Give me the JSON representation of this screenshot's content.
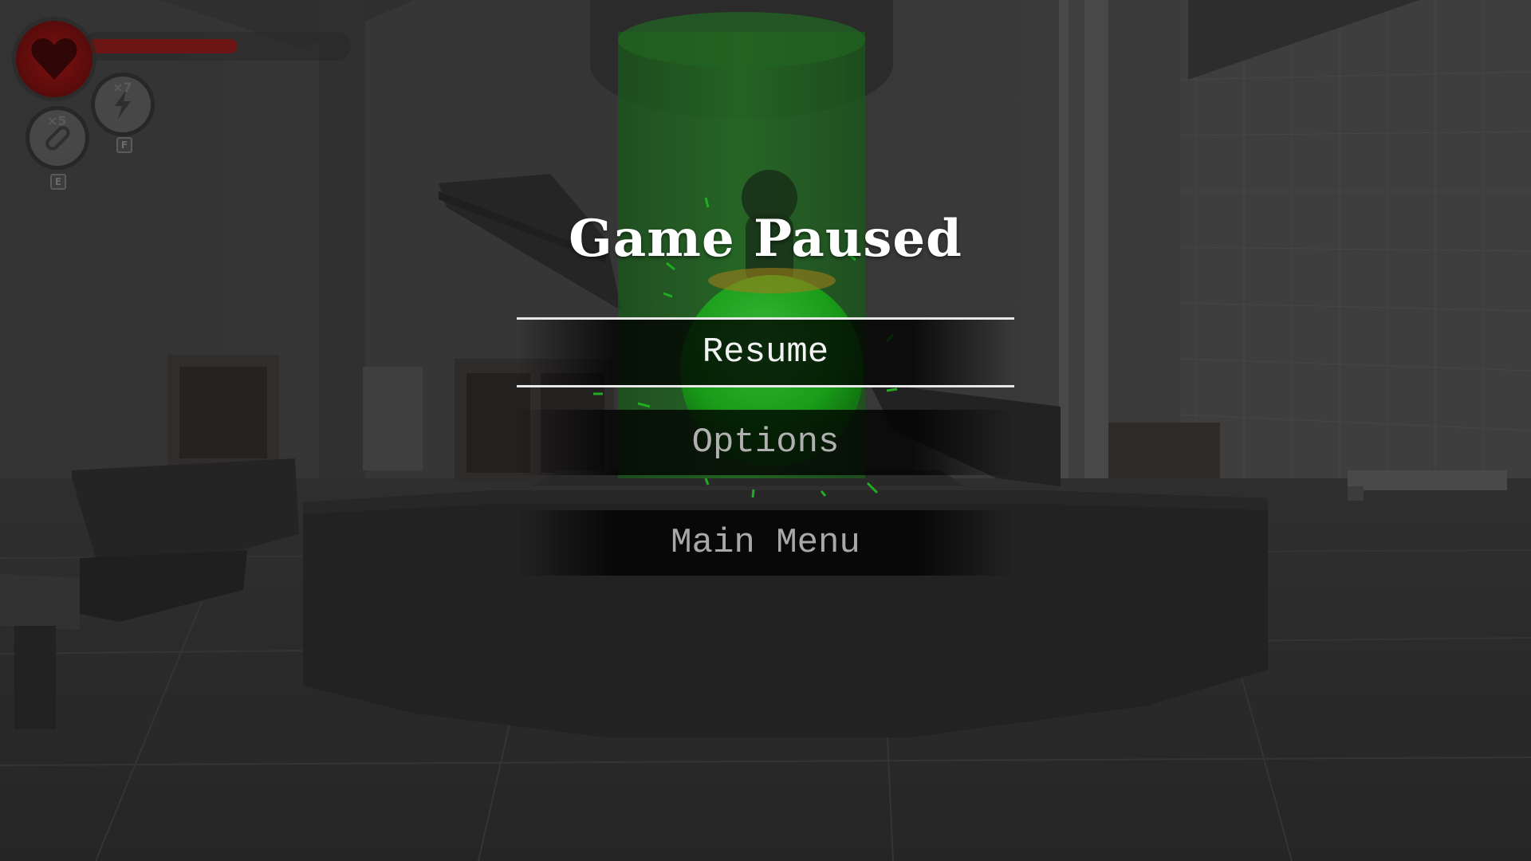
{
  "menu": {
    "title": "Game Paused",
    "items": [
      {
        "label": "Resume",
        "selected": true
      },
      {
        "label": "Options",
        "selected": false
      },
      {
        "label": "Main Menu",
        "selected": false
      }
    ]
  },
  "hud": {
    "health_fraction": 0.58,
    "items": [
      {
        "icon": "lightning-icon",
        "count": "×7",
        "key": "F"
      },
      {
        "icon": "pill-icon",
        "count": "×5",
        "key": "E"
      }
    ]
  },
  "colors": {
    "health": "#6b1515",
    "heart": "#7a1010",
    "tank_glow": "#2fd12f"
  }
}
